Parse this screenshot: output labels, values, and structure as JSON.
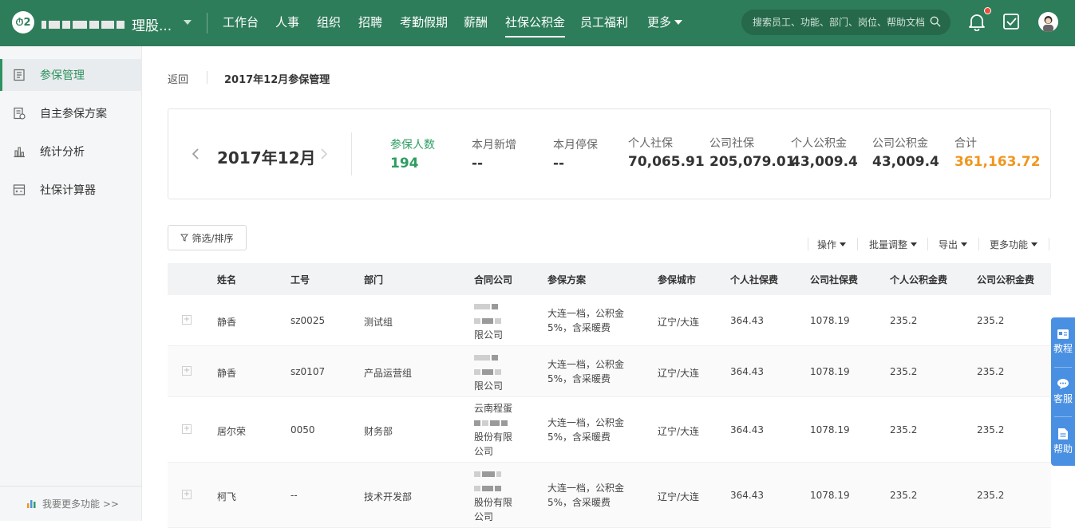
{
  "topbar": {
    "logo": "2",
    "company_suffix": "理股...",
    "nav": [
      {
        "label": "工作台"
      },
      {
        "label": "人事"
      },
      {
        "label": "组织"
      },
      {
        "label": "招聘"
      },
      {
        "label": "考勤假期"
      },
      {
        "label": "薪酬"
      },
      {
        "label": "社保公积金",
        "active": true
      },
      {
        "label": "员工福利"
      },
      {
        "label": "更多"
      }
    ],
    "search_placeholder": "搜索员工、功能、部门、岗位、帮助文档"
  },
  "sidebar": {
    "items": [
      {
        "label": "参保管理",
        "icon": "insurance-doc-icon",
        "active": true
      },
      {
        "label": "自主参保方案",
        "icon": "plan-icon"
      },
      {
        "label": "统计分析",
        "icon": "bar-chart-icon"
      },
      {
        "label": "社保计算器",
        "icon": "calculator-icon"
      }
    ],
    "footer": "我要更多功能 >>"
  },
  "breadcrumb": {
    "back": "返回",
    "title": "2017年12月参保管理"
  },
  "summary": {
    "month": "2017年12月",
    "stats": [
      {
        "label": "参保人数",
        "value": "194"
      },
      {
        "label": "本月新增",
        "value": "--"
      },
      {
        "label": "本月停保",
        "value": "--"
      },
      {
        "label": "个人社保",
        "value": "70,065.91"
      },
      {
        "label": "公司社保",
        "value": "205,079.01"
      },
      {
        "label": "个人公积金",
        "value": "43,009.4"
      },
      {
        "label": "公司公积金",
        "value": "43,009.4"
      },
      {
        "label": "合计",
        "value": "361,163.72"
      }
    ]
  },
  "toolbar": {
    "filter": "筛选/排序",
    "actions": [
      "操作",
      "批量调整",
      "导出",
      "更多功能"
    ]
  },
  "table": {
    "headers": [
      "姓名",
      "工号",
      "部门",
      "合同公司",
      "参保方案",
      "参保城市",
      "个人社保费",
      "公司社保费",
      "个人公积金费",
      "公司公积金费"
    ],
    "rows": [
      {
        "name": "静香",
        "id": "sz0025",
        "dept": "测试组",
        "company_tail": "限公司",
        "plan_line1": "大连一档，公积金",
        "plan_line2": "5%，含采暖费",
        "city": "辽宁/大连",
        "p_ss": "364.43",
        "c_ss": "1078.19",
        "p_hf": "235.2",
        "c_hf": "235.2"
      },
      {
        "name": "静香",
        "id": "sz0107",
        "dept": "产品运营组",
        "company_tail": "限公司",
        "plan_line1": "大连一档，公积金",
        "plan_line2": "5%，含采暖费",
        "city": "辽宁/大连",
        "p_ss": "364.43",
        "c_ss": "1078.19",
        "p_hf": "235.2",
        "c_hf": "235.2"
      },
      {
        "name": "居尔荣",
        "id": "0050",
        "dept": "财务部",
        "company_head": "云南程蛋",
        "company_tail": "股份有限",
        "company_tail2": "公司",
        "plan_line1": "大连一档，公积金",
        "plan_line2": "5%，含采暖费",
        "city": "辽宁/大连",
        "p_ss": "364.43",
        "c_ss": "1078.19",
        "p_hf": "235.2",
        "c_hf": "235.2"
      },
      {
        "name": "柯飞",
        "id": "--",
        "dept": "技术开发部",
        "company_tail": "股份有限",
        "company_tail2": "公司",
        "plan_line1": "大连一档，公积金",
        "plan_line2": "5%，含采暖费",
        "city": "辽宁/大连",
        "p_ss": "364.43",
        "c_ss": "1078.19",
        "p_hf": "235.2",
        "c_hf": "235.2"
      }
    ]
  },
  "float_help": [
    "教程",
    "客服",
    "帮助"
  ],
  "colors": {
    "brand": "#2e7d5a",
    "accent_green": "#2e9d62",
    "total_orange": "#f0961e",
    "help_blue": "#4a90e2"
  }
}
